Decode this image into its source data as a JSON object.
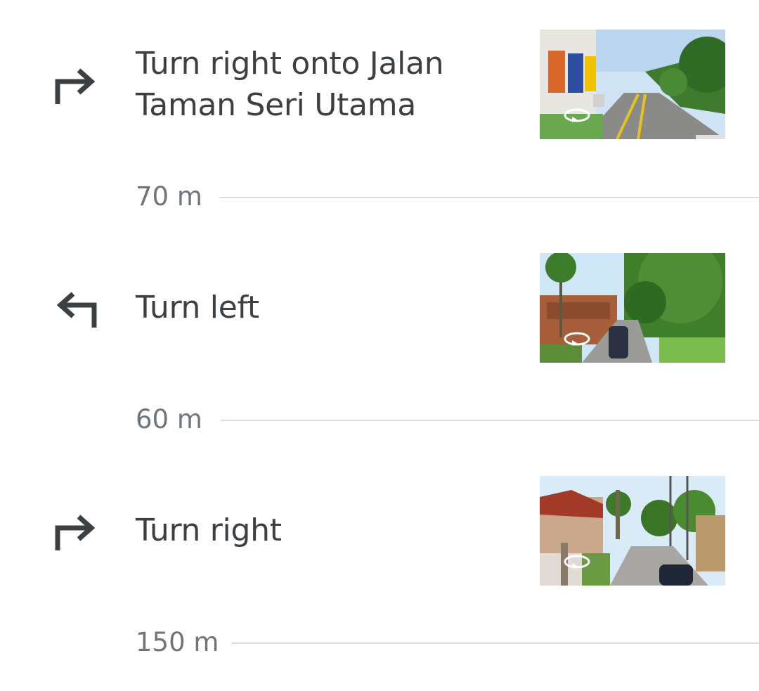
{
  "steps": [
    {
      "instruction": "Turn right onto Jalan Taman Seri Utama",
      "turn_icon": "turn-right-icon",
      "distance": "70 m",
      "street_view_icon": "360-rotate-icon"
    },
    {
      "instruction": "Turn left",
      "turn_icon": "turn-left-icon",
      "distance": "60 m",
      "street_view_icon": "360-rotate-icon"
    },
    {
      "instruction": "Turn right",
      "turn_icon": "turn-right-icon",
      "distance": "150 m",
      "street_view_icon": "360-rotate-icon"
    }
  ],
  "colors": {
    "text": "#3c4043",
    "distance_text": "#70757a",
    "divider": "#dadce0",
    "icon": "#3c4043"
  }
}
